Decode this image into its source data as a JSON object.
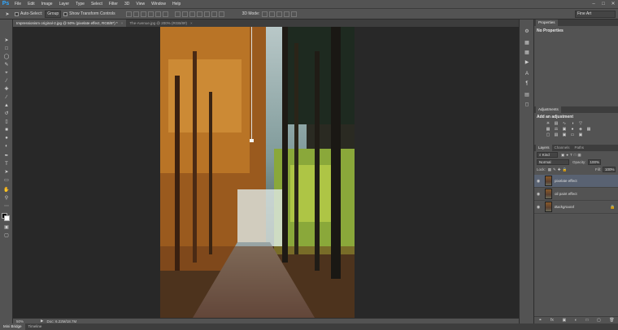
{
  "app": {
    "logo": "Ps"
  },
  "menu": [
    "File",
    "Edit",
    "Image",
    "Layer",
    "Type",
    "Select",
    "Filter",
    "3D",
    "View",
    "Window",
    "Help"
  ],
  "window_controls": [
    "–",
    "□",
    "✕"
  ],
  "options": {
    "auto_select_label": "Auto-Select:",
    "auto_select_value": "Group",
    "show_transform_label": "Show Transform Controls",
    "mode_3d_label": "3D Mode:",
    "workspace": "Fine Art"
  },
  "tabs": [
    {
      "label": "Impressionism original-2.jpg @ 50% (pixelate effect, RGB/8*) *",
      "close": "×"
    },
    {
      "label": "The-Avenue.jpg @ 200% (RGB/8#)",
      "close": "×"
    }
  ],
  "status": {
    "zoom": "50%",
    "doc": "Doc: 6.22M/18.7M",
    "arrow": "▶"
  },
  "bottom_tabs": [
    "Mini Bridge",
    "Timeline"
  ],
  "properties": {
    "tab": "Properties",
    "content": "No Properties"
  },
  "adjustments": {
    "tab": "Adjustments",
    "title": "Add an adjustment"
  },
  "layers": {
    "tabs": [
      "Layers",
      "Channels",
      "Paths"
    ],
    "kind_label": "⌕ Kind",
    "blend_mode": "Normal",
    "opacity_label": "Opacity:",
    "opacity_value": "100%",
    "lock_label": "Lock:",
    "fill_label": "Fill:",
    "fill_value": "100%",
    "items": [
      {
        "name": "pixelate effect",
        "visible": true,
        "selected": true
      },
      {
        "name": "oil paint effect",
        "visible": true,
        "selected": false
      },
      {
        "name": "Background",
        "visible": true,
        "selected": false,
        "locked": true
      }
    ]
  },
  "colors": {
    "panel_bg": "#535353",
    "canvas_bg": "#282828",
    "selection": "#596272",
    "ps_blue": "#31a8ff"
  }
}
